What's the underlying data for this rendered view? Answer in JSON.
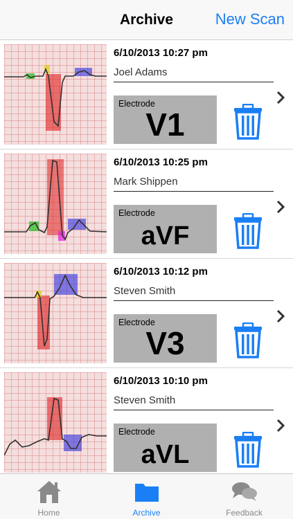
{
  "nav": {
    "title": "Archive",
    "action": "New Scan"
  },
  "scans": [
    {
      "datetime": "6/10/2013 10:27 pm",
      "patient": "Joel Adams",
      "electrode_label": "Electrode",
      "electrode": "V1"
    },
    {
      "datetime": "6/10/2013 10:25 pm",
      "patient": "Mark Shippen",
      "electrode_label": "Electrode",
      "electrode": "aVF"
    },
    {
      "datetime": "6/10/2013 10:12 pm",
      "patient": "Steven Smith",
      "electrode_label": "Electrode",
      "electrode": "V3"
    },
    {
      "datetime": "6/10/2013 10:10 pm",
      "patient": "Steven Smith",
      "electrode_label": "Electrode",
      "electrode": "aVL"
    }
  ],
  "tabs": [
    {
      "label": "Home",
      "icon": "home-icon"
    },
    {
      "label": "Archive",
      "icon": "folder-icon"
    },
    {
      "label": "Feedback",
      "icon": "chat-bubbles-icon"
    }
  ],
  "active_tab": "Archive",
  "colors": {
    "accent": "#1a7ff5",
    "electrode_bg": "#b0b0b0",
    "trash": "#1a7ff5"
  }
}
